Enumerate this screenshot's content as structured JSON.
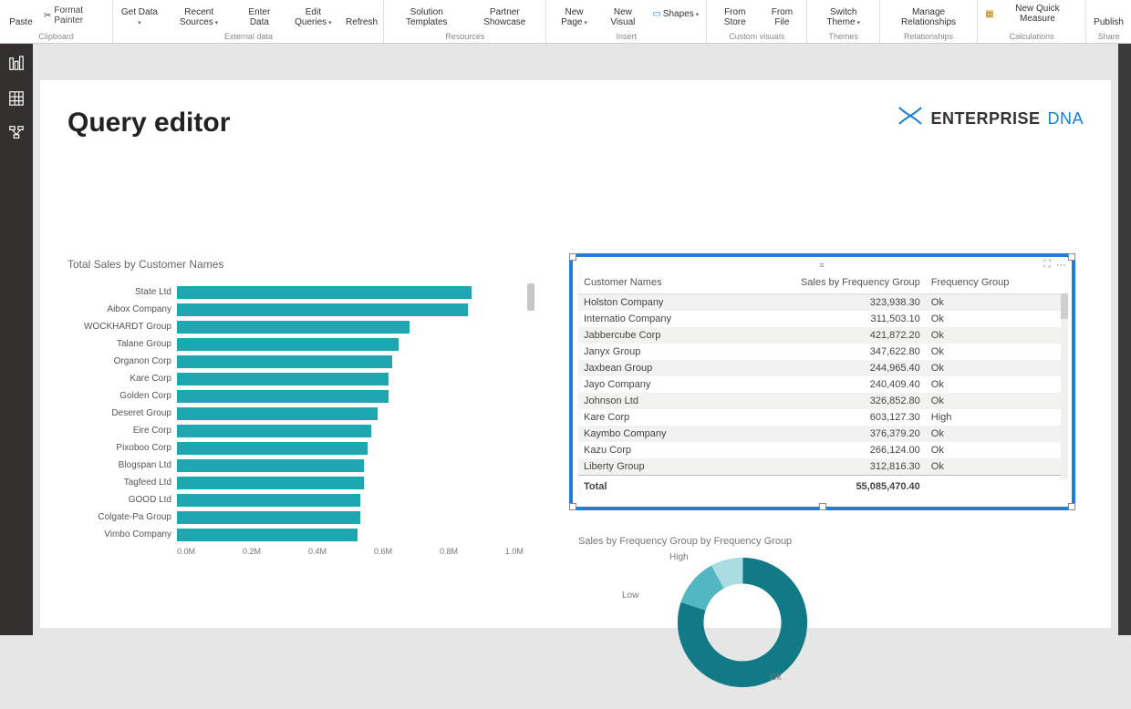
{
  "ribbon": {
    "paste": "Paste",
    "format_painter": "Format Painter",
    "clipboard_label": "Clipboard",
    "get_data": "Get\nData",
    "recent_sources": "Recent\nSources",
    "enter_data": "Enter\nData",
    "edit_queries": "Edit\nQueries",
    "refresh": "Refresh",
    "external_data_label": "External data",
    "solution_templates": "Solution\nTemplates",
    "partner_showcase": "Partner\nShowcase",
    "resources_label": "Resources",
    "new_page": "New\nPage",
    "new_visual": "New\nVisual",
    "shapes": "Shapes",
    "insert_label": "Insert",
    "from_store": "From\nStore",
    "from_file": "From\nFile",
    "custom_visuals_label": "Custom visuals",
    "switch_theme": "Switch\nTheme",
    "themes_label": "Themes",
    "manage_relationships": "Manage\nRelationships",
    "relationships_label": "Relationships",
    "new_quick_measure": "New Quick Measure",
    "calculations_label": "Calculations",
    "publish": "Publish",
    "share_label": "Share"
  },
  "page": {
    "title": "Query editor",
    "logo_bold": "ENTERPRISE",
    "logo_light": "DNA"
  },
  "chart_data": [
    {
      "type": "bar",
      "title": "Total Sales by Customer Names",
      "orientation": "horizontal",
      "xlabel": "",
      "ylabel": "",
      "xlim": [
        0,
        1.0
      ],
      "x_ticks": [
        "0.0M",
        "0.2M",
        "0.4M",
        "0.6M",
        "0.8M",
        "1.0M"
      ],
      "categories": [
        "State Ltd",
        "Aibox Company",
        "WOCKHARDT Group",
        "Talane Group",
        "Organon Corp",
        "Kare Corp",
        "Golden Corp",
        "Deseret Group",
        "Eire Corp",
        "Pixoboo Corp",
        "Blogspan Ltd",
        "Tagfeed Ltd",
        "GOOD Ltd",
        "Colgate-Pa Group",
        "Vimbo Company"
      ],
      "values": [
        0.85,
        0.84,
        0.67,
        0.64,
        0.62,
        0.61,
        0.61,
        0.58,
        0.56,
        0.55,
        0.54,
        0.54,
        0.53,
        0.53,
        0.52
      ],
      "color": "#1ea7b0"
    },
    {
      "type": "table",
      "columns": [
        "Customer Names",
        "Sales by Frequency Group",
        "Frequency Group"
      ],
      "rows": [
        [
          "Holston Company",
          "323,938.30",
          "Ok"
        ],
        [
          "Internatio Company",
          "311,503.10",
          "Ok"
        ],
        [
          "Jabbercube Corp",
          "421,872.20",
          "Ok"
        ],
        [
          "Janyx Group",
          "347,622.80",
          "Ok"
        ],
        [
          "Jaxbean Group",
          "244,965.40",
          "Ok"
        ],
        [
          "Jayo Company",
          "240,409.40",
          "Ok"
        ],
        [
          "Johnson Ltd",
          "326,852.80",
          "Ok"
        ],
        [
          "Kare Corp",
          "603,127.30",
          "High"
        ],
        [
          "Kaymbo Company",
          "376,379.20",
          "Ok"
        ],
        [
          "Kazu Corp",
          "266,124.00",
          "Ok"
        ],
        [
          "Liberty Group",
          "312,816.30",
          "Ok"
        ]
      ],
      "total_label": "Total",
      "total_value": "55,085,470.40"
    },
    {
      "type": "pie",
      "title": "Sales by Frequency Group by Frequency Group",
      "series": [
        {
          "name": "Ok",
          "value": 80,
          "color": "#127a87"
        },
        {
          "name": "Low",
          "value": 12,
          "color": "#52b7c1"
        },
        {
          "name": "High",
          "value": 8,
          "color": "#a9dde2"
        }
      ]
    }
  ]
}
